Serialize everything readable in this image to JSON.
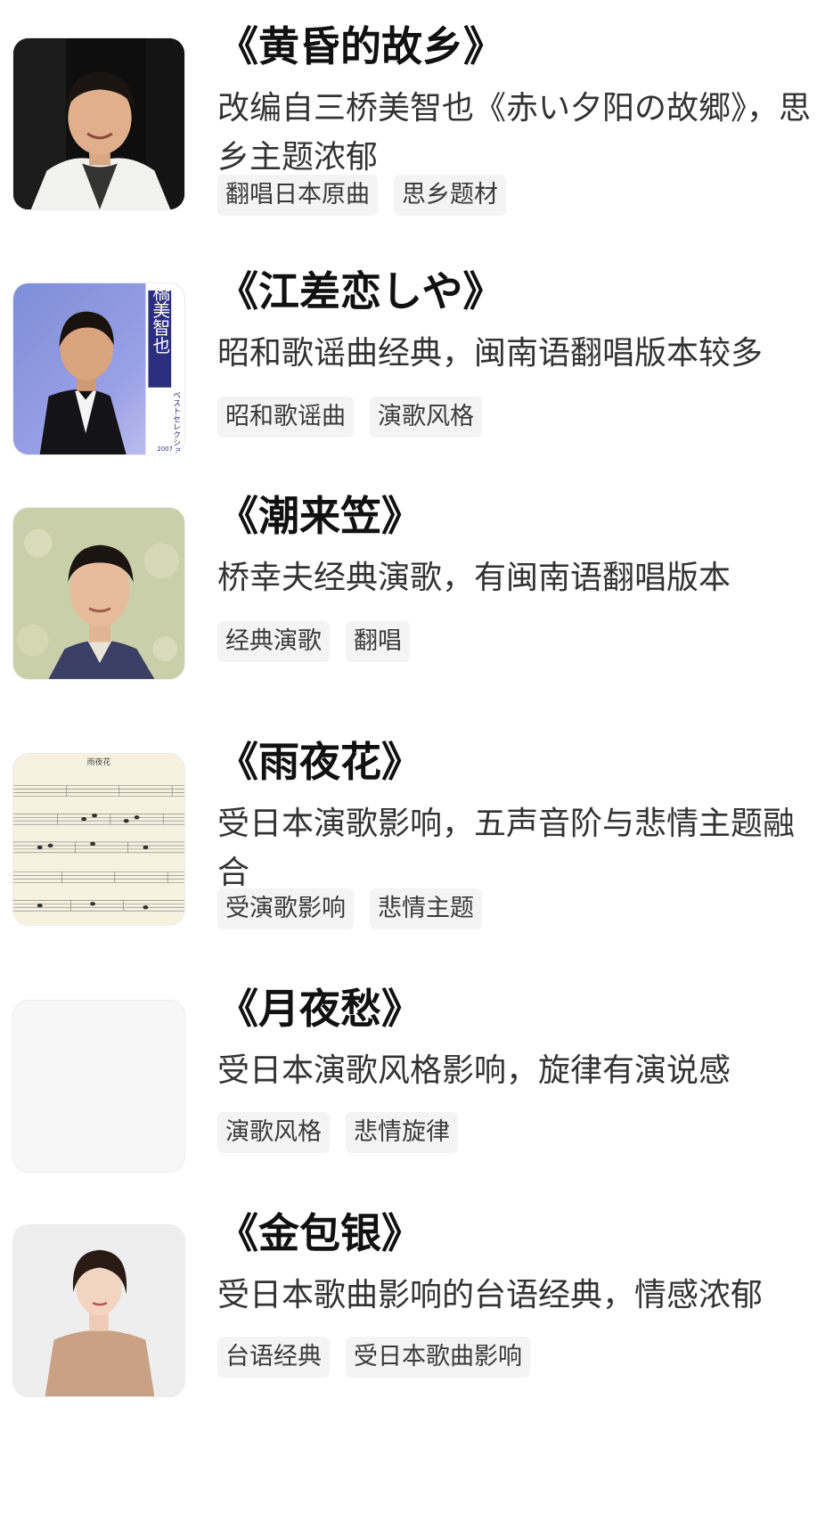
{
  "songs": [
    {
      "title": "《黄昏的故乡》",
      "desc": "改编自三桥美智也《赤い夕阳の故郷》，思乡主题浓郁",
      "tags": [
        "翻唱日本原曲",
        "思乡题材"
      ],
      "image": "singer-portrait-white-suit"
    },
    {
      "title": "《江差恋しや》",
      "desc": "昭和歌谣曲经典，闽南语翻唱版本较多",
      "tags": [
        "昭和歌谣曲",
        "演歌风格"
      ],
      "image": "album-cover",
      "cover_text": {
        "vertical_name": "三橋美智也",
        "subtitle": "ベストセレクション",
        "year": "2007"
      }
    },
    {
      "title": "《潮来笠》",
      "desc": "桥幸夫经典演歌，有闽南语翻唱版本",
      "tags": [
        "经典演歌",
        "翻唱"
      ],
      "image": "singer-portrait-kimono"
    },
    {
      "title": "《雨夜花》",
      "desc": "受日本演歌影响，五声音阶与悲情主题融合",
      "tags": [
        "受演歌影响",
        "悲情主题"
      ],
      "image": "sheet-music",
      "cover_text": {
        "sheet_title": "雨夜花"
      }
    },
    {
      "title": "《月夜愁》",
      "desc": "受日本演歌风格影响，旋律有演说感",
      "tags": [
        "演歌风格",
        "悲情旋律"
      ],
      "image": "blank-placeholder"
    },
    {
      "title": "《金包银》",
      "desc": "受日本歌曲影响的台语经典，情感浓郁",
      "tags": [
        "台语经典",
        "受日本歌曲影响"
      ],
      "image": "singer-portrait-woman"
    }
  ]
}
